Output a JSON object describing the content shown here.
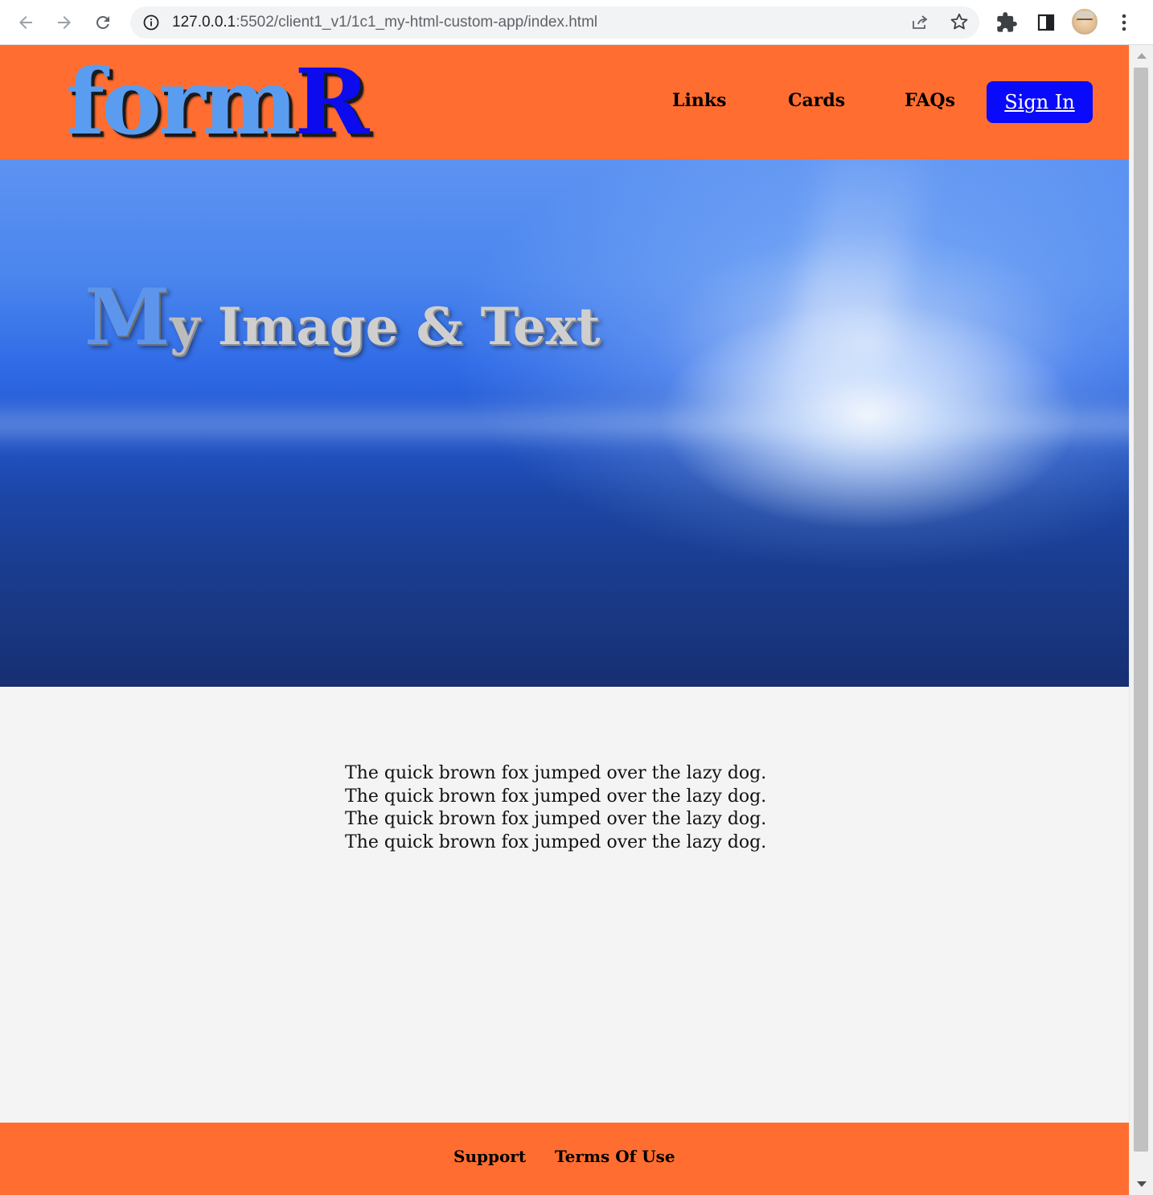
{
  "browser": {
    "url_host": "127.0.0.1",
    "url_path": ":5502/client1_v1/1c1_my-html-custom-app/index.html",
    "icons": [
      "back-arrow-icon",
      "forward-arrow-icon",
      "reload-icon",
      "info-icon",
      "share-icon",
      "star-icon",
      "extensions-puzzle-icon",
      "side-panel-icon",
      "profile-avatar",
      "kebab-menu-icon"
    ]
  },
  "header": {
    "logo_part1": "form",
    "logo_part2": "R",
    "nav": {
      "links": "Links",
      "cards": "Cards",
      "faqs": "FAQs",
      "sign_in": "Sign In"
    },
    "colors": {
      "background": "#ff6e30",
      "sign_in_button": "#0a0afb",
      "logo_form": "#5a9cf0",
      "logo_r": "#0b0bee"
    }
  },
  "hero": {
    "title_cap": "M",
    "title_y": "y",
    "title_rest": " Image & Text"
  },
  "content": {
    "lines": [
      "The quick brown fox jumped over the lazy dog.",
      "The quick brown fox jumped over the lazy dog.",
      "The quick brown fox jumped over the lazy dog.",
      "The quick brown fox jumped over the lazy dog."
    ]
  },
  "footer": {
    "support": "Support",
    "terms": "Terms Of Use"
  }
}
